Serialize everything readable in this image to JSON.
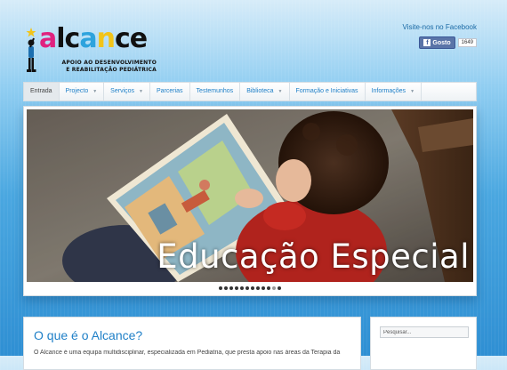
{
  "header": {
    "logo_word": [
      "a",
      "l",
      "c",
      "a",
      "n",
      "c",
      "e"
    ],
    "tagline_1": "APOIO AO DESENVOLVIMENTO",
    "tagline_2": "E REABILITAÇÃO PEDIÁTRICA",
    "facebook_link": "Visite-nos no Facebook",
    "like_label": "Gosto",
    "like_count": "1649"
  },
  "nav": {
    "items": [
      {
        "label": "Entrada"
      },
      {
        "label": "Projecto"
      },
      {
        "label": "Serviços"
      },
      {
        "label": "Parcerias"
      },
      {
        "label": "Testemunhos"
      },
      {
        "label": "Biblioteca"
      },
      {
        "label": "Formação e Iniciativas"
      },
      {
        "label": "Informações"
      }
    ]
  },
  "slider": {
    "title": "Educação Especial",
    "slide_count": 12,
    "active_slide": 10
  },
  "main": {
    "heading": "O que é o Alcance?",
    "intro": "O Alcance é uma equipa multidisciplinar, especializada em Pediatria, que presta apoio nas áreas da Terapia da"
  },
  "sidebar": {
    "search_placeholder": "Pesquisar..."
  },
  "colors": {
    "link": "#1e7fc7",
    "background_top": "#d7ecf9",
    "background_bottom": "#2f8fd3"
  }
}
